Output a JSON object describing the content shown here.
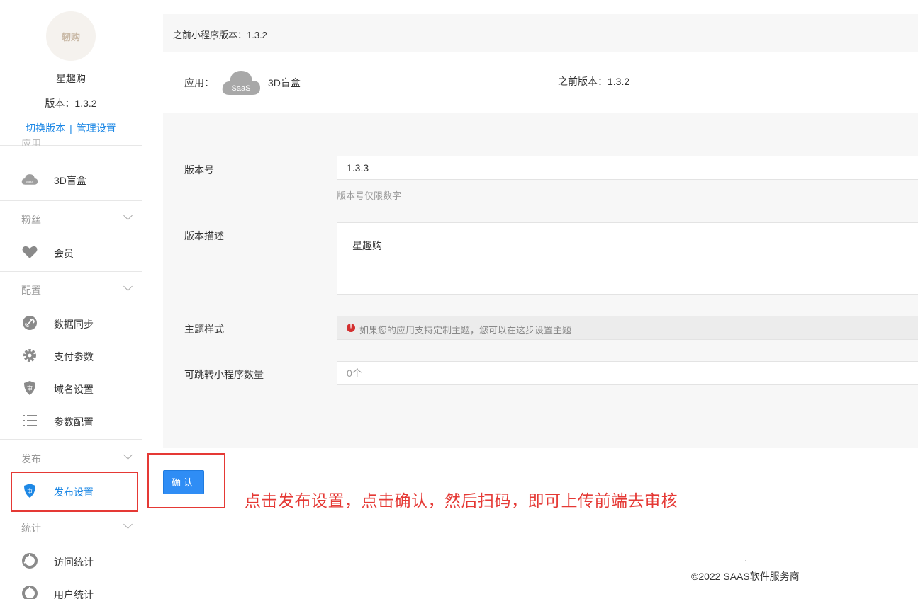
{
  "sidebar": {
    "logo_text": "轫购",
    "app_name": "星趣购",
    "version": "版本：1.3.2",
    "links": {
      "switch_version": "切换版本",
      "separator": "|",
      "manage_settings": "管理设置"
    },
    "partial_label": "应用",
    "app_item": "3D盲盒",
    "sections": {
      "fans": {
        "title": "粉丝",
        "items": [
          "会员"
        ]
      },
      "config": {
        "title": "配置",
        "items": [
          "数据同步",
          "支付参数",
          "域名设置",
          "参数配置"
        ]
      },
      "publish": {
        "title": "发布",
        "items": [
          "发布设置"
        ]
      },
      "stats": {
        "title": "统计",
        "items": [
          "访问统计",
          "用户统计"
        ]
      }
    },
    "icons": {
      "app": "saas-cloud-icon",
      "member": "heart-icon",
      "sync": "link-icon",
      "pay": "gear-icon",
      "domain": "shield-icon",
      "params": "list-icon",
      "publish": "shield-check-icon",
      "visit": "pie-chart-icon",
      "user": "pie-chart-icon"
    },
    "active_color": "#1e88e5"
  },
  "main": {
    "top_bar_text": "之前小程序版本：1.3.2",
    "app_row": {
      "label": "应用：",
      "cloud_text": "SaaS",
      "name": "3D盲盒",
      "prev_version": "之前版本：1.3.2"
    },
    "form": {
      "version_label": "版本号",
      "version_value": "1.3.3",
      "version_hint": "版本号仅限数字",
      "desc_label": "版本描述",
      "desc_value": "星趣购",
      "theme_label": "主题样式",
      "theme_warning": "如果您的应用支持定制主题，您可以在这步设置主题",
      "warn_mark": "!",
      "jump_label": "可跳转小程序数量",
      "jump_value": "0个"
    },
    "confirm_label": "确认",
    "annotation": "点击发布设置，点击确认，然后扫码，即可上传前端去审核"
  },
  "footer": {
    "dot": ".",
    "copyright": "©2022 SAAS软件服务商"
  },
  "colors": {
    "accent": "#2f8df5",
    "annotation_red": "#e53935"
  }
}
